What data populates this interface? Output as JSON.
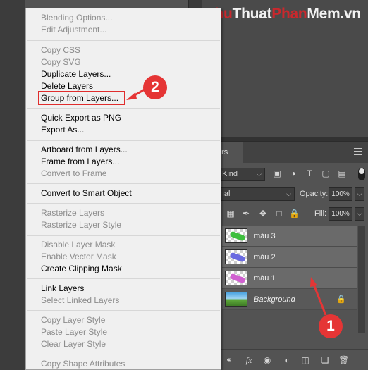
{
  "watermark": {
    "part1": "Thu",
    "part2": "Thuat",
    "part3": "Phan",
    "part4": "Mem",
    "part5": ".vn"
  },
  "context_menu": {
    "items": [
      {
        "label": "Blending Options...",
        "enabled": false
      },
      {
        "label": "Edit Adjustment...",
        "enabled": false
      },
      {
        "label": "Copy CSS",
        "enabled": false
      },
      {
        "label": "Copy SVG",
        "enabled": false
      },
      {
        "label": "Duplicate Layers...",
        "enabled": true
      },
      {
        "label": "Delete Layers",
        "enabled": true
      },
      {
        "label": "Group from Layers...",
        "enabled": true
      },
      {
        "label": "Quick Export as PNG",
        "enabled": true
      },
      {
        "label": "Export As...",
        "enabled": true
      },
      {
        "label": "Artboard from Layers...",
        "enabled": true
      },
      {
        "label": "Frame from Layers...",
        "enabled": true
      },
      {
        "label": "Convert to Frame",
        "enabled": false
      },
      {
        "label": "Convert to Smart Object",
        "enabled": true
      },
      {
        "label": "Rasterize Layers",
        "enabled": false
      },
      {
        "label": "Rasterize Layer Style",
        "enabled": false
      },
      {
        "label": "Disable Layer Mask",
        "enabled": false
      },
      {
        "label": "Enable Vector Mask",
        "enabled": false
      },
      {
        "label": "Create Clipping Mask",
        "enabled": true
      },
      {
        "label": "Link Layers",
        "enabled": true
      },
      {
        "label": "Select Linked Layers",
        "enabled": false
      },
      {
        "label": "Copy Layer Style",
        "enabled": false
      },
      {
        "label": "Paste Layer Style",
        "enabled": false
      },
      {
        "label": "Clear Layer Style",
        "enabled": false
      },
      {
        "label": "Copy Shape Attributes",
        "enabled": false
      }
    ]
  },
  "layers_panel": {
    "tab_label": "ers",
    "filter_kind": "Kind",
    "blend_mode": "rmal",
    "opacity_label": "Opacity:",
    "opacity_value": "100%",
    "fill_label": "Fill:",
    "fill_value": "100%",
    "layers": [
      {
        "name": "màu 3",
        "stroke_color": "#3fbf3f",
        "selected": true
      },
      {
        "name": "màu 2",
        "stroke_color": "#6a6ae0",
        "selected": true
      },
      {
        "name": "màu 1",
        "stroke_color": "#d060d0",
        "selected": true
      },
      {
        "name": "Background",
        "locked": true,
        "selected": false
      }
    ]
  },
  "annotations": {
    "badge_1": "1",
    "badge_2": "2",
    "highlight_color": "#e02d2d"
  }
}
